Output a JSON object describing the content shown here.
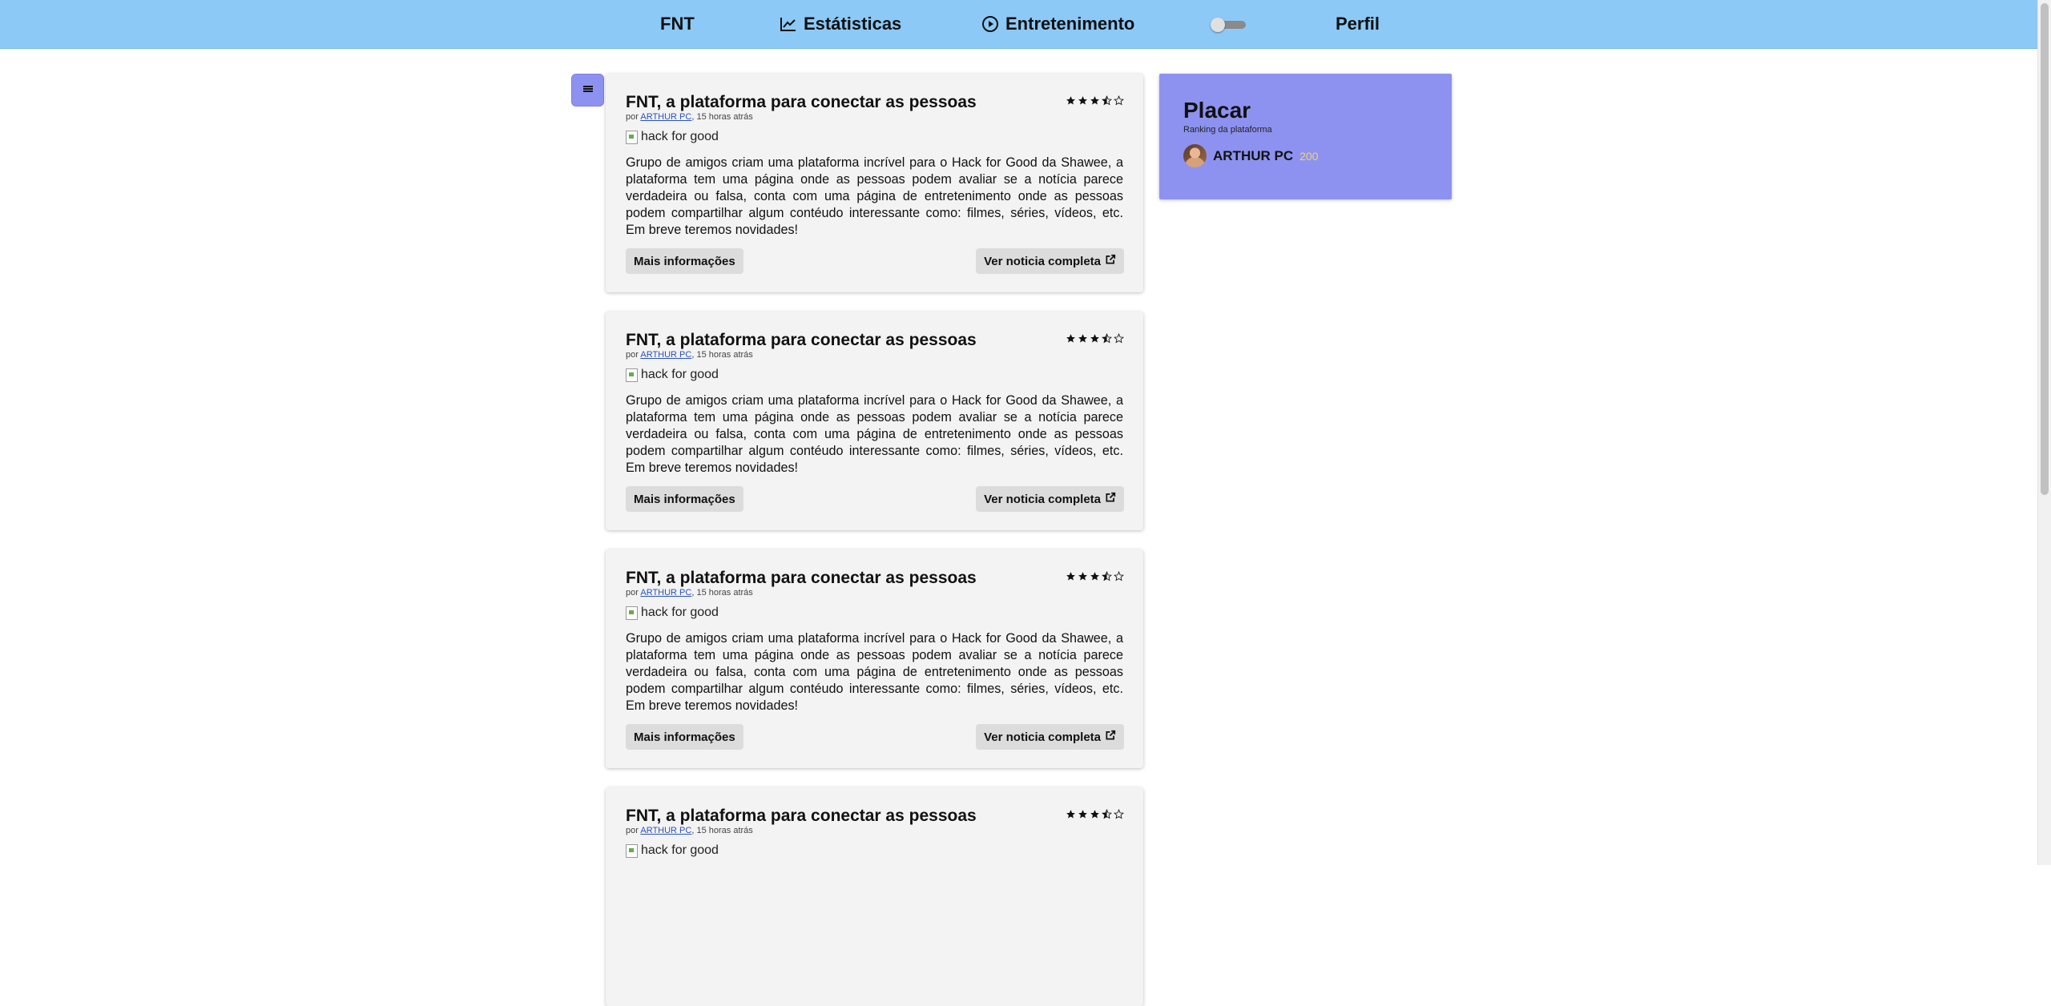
{
  "nav": {
    "brand": "FNT",
    "stats_label": "Estátisticas",
    "entertainment_label": "Entretenimento",
    "profile_label": "Perfil"
  },
  "posts": [
    {
      "title": "FNT, a plataforma para conectar as pessoas",
      "rating": 3.5,
      "by_prefix": "por",
      "author": "ARTHUR PC",
      "time": ", 15 horas atrás",
      "image_alt": "hack for good",
      "body": "Grupo de amigos criam uma plataforma incrível para o Hack for Good da Shawee, a plataforma tem uma página onde as pessoas podem avaliar se a notícia parece verdadeira ou falsa, conta com uma página de entretenimento onde as pessoas podem compartilhar algum contéudo interessante como: filmes, séries, vídeos, etc. Em breve teremos novidades!",
      "more_label": "Mais informações",
      "full_label": "Ver noticia completa"
    },
    {
      "title": "FNT, a plataforma para conectar as pessoas",
      "rating": 3.5,
      "by_prefix": "por",
      "author": "ARTHUR PC",
      "time": ", 15 horas atrás",
      "image_alt": "hack for good",
      "body": "Grupo de amigos criam uma plataforma incrível para o Hack for Good da Shawee, a plataforma tem uma página onde as pessoas podem avaliar se a notícia parece verdadeira ou falsa, conta com uma página de entretenimento onde as pessoas podem compartilhar algum contéudo interessante como: filmes, séries, vídeos, etc. Em breve teremos novidades!",
      "more_label": "Mais informações",
      "full_label": "Ver noticia completa"
    },
    {
      "title": "FNT, a plataforma para conectar as pessoas",
      "rating": 3.5,
      "by_prefix": "por",
      "author": "ARTHUR PC",
      "time": ", 15 horas atrás",
      "image_alt": "hack for good",
      "body": "Grupo de amigos criam uma plataforma incrível para o Hack for Good da Shawee, a plataforma tem uma página onde as pessoas podem avaliar se a notícia parece verdadeira ou falsa, conta com uma página de entretenimento onde as pessoas podem compartilhar algum contéudo interessante como: filmes, séries, vídeos, etc. Em breve teremos novidades!",
      "more_label": "Mais informações",
      "full_label": "Ver noticia completa"
    },
    {
      "title": "FNT, a plataforma para conectar as pessoas",
      "rating": 3.5,
      "by_prefix": "por",
      "author": "ARTHUR PC",
      "time": ", 15 horas atrás",
      "image_alt": "hack for good",
      "body": "",
      "more_label": "",
      "full_label": ""
    }
  ],
  "scoreboard": {
    "title": "Placar",
    "subtitle": "Ranking da plataforma",
    "entries": [
      {
        "name": "ARTHUR PC",
        "points": "200"
      }
    ]
  },
  "colors": {
    "nav_bg": "#8cc9f7",
    "accent": "#8d92f0",
    "points": "#f3d36b",
    "link": "#2952c4"
  }
}
